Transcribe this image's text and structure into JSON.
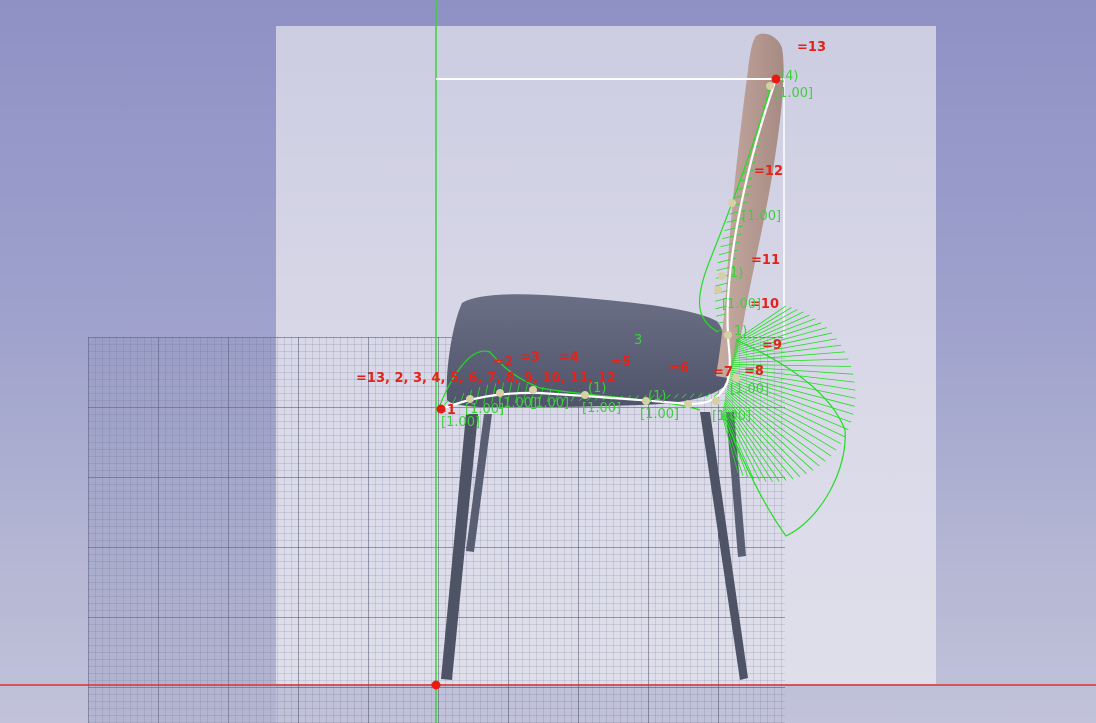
{
  "viewport": {
    "name": "Sketcher 3D view",
    "colors": {
      "background_top": "#8f91c6",
      "background_bottom": "#c2c3da",
      "backdrop_panel": "#d4d4e6",
      "grid": "#3c3f5e",
      "axis_vertical": "#39d339",
      "axis_horizontal": "#d83333",
      "spline": "#ffffff",
      "curvature_comb": "#22dd22",
      "constraint_text": "#e2231a",
      "datum_text": "#3ecf3e",
      "control_point": "#d6d0a6",
      "endpoint": "#e81a0f",
      "chair_seat": "#5e6278",
      "chair_back": "#b5988f",
      "chair_leg": "#4f5366"
    }
  },
  "constraints": {
    "bottom_knots": "13, 2, 3, 4, 5, 6, 7, 8, 9, 10, 11, 12",
    "c1": "1",
    "c2": "2",
    "c3": "3",
    "c4": "4",
    "c5": "5",
    "c6": "6",
    "c7": "7",
    "c8": "8",
    "c9": "9",
    "c10": "10",
    "c11": "11",
    "c12": "12",
    "c13": "13"
  },
  "datums": {
    "top_index": "(4)",
    "top_weight": "[1.00]",
    "back_upper_weight": "[1.00]",
    "back_mid_index": "1)",
    "back_lower_weight": "[1.00]",
    "back_bottom_index": "1)",
    "seat_front_index": "3",
    "right_weight_1": "[1.00]",
    "right_weight_2": "[1.00]",
    "seat_weight_1": "[1.00]",
    "seat_weight_2": "[1.00]",
    "seat_weight_3": "[1.00]",
    "seat_weight_4": "[1.00]",
    "seat_index_1": "(1)",
    "seat_index_2": "(1)",
    "left_weight_a": "[1.00]",
    "left_weight_b": "[1.00]"
  }
}
